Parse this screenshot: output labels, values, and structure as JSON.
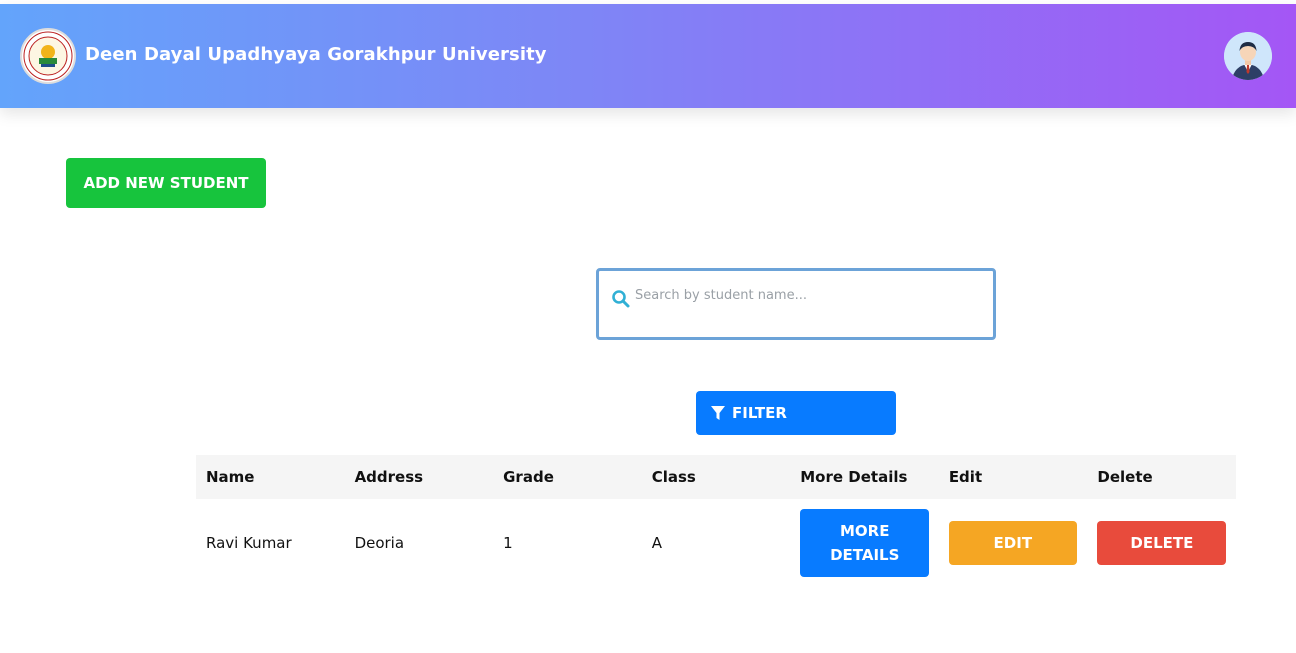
{
  "header": {
    "title": "Deen Dayal Upadhyaya Gorakhpur University",
    "logo_icon": "university-seal-icon",
    "avatar_icon": "user-avatar-icon",
    "gradient_start": "#63a4fb",
    "gradient_end": "#a456f5"
  },
  "actions": {
    "add_label": "ADD NEW STUDENT",
    "add_color": "#17c43d",
    "filter_label": "FILTER",
    "filter_color": "#087bff"
  },
  "search": {
    "placeholder": "Search by student name...",
    "value": ""
  },
  "table": {
    "headers": [
      "Name",
      "Address",
      "Grade",
      "Class",
      "More Details",
      "Edit",
      "Delete"
    ],
    "rows": [
      {
        "name": "Ravi Kumar",
        "address": "Deoria",
        "grade": "1",
        "class": "A",
        "more_label_line1": "MORE",
        "more_label_line2": "DETAILS",
        "edit_label": "EDIT",
        "delete_label": "DELETE"
      }
    ]
  },
  "colors": {
    "edit": "#f5a623",
    "delete": "#e84b3c",
    "more_details": "#087bff"
  }
}
